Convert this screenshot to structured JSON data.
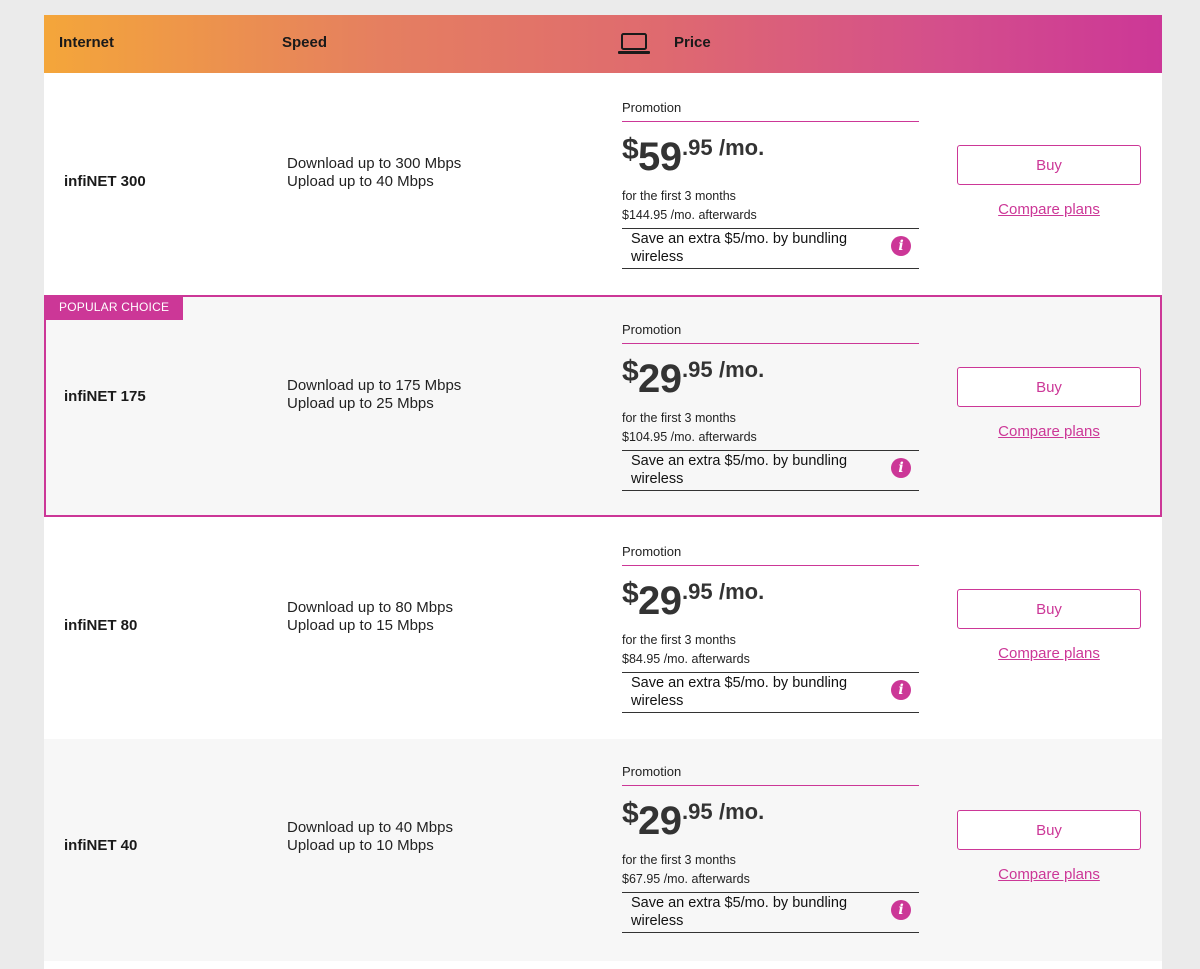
{
  "header": {
    "internet": "Internet",
    "speed": "Speed",
    "price": "Price"
  },
  "badge": "POPULAR CHOICE",
  "plans": [
    {
      "name": "infiNET 300",
      "download": "Download up to 300 Mbps",
      "upload": "Upload up to 40 Mbps",
      "promo_label": "Promotion",
      "dollar": "$",
      "price_main": "59",
      "price_cents": ".95",
      "price_unit": "/mo.",
      "term": "for the first 3 months",
      "after": "$144.95 /mo. afterwards",
      "bundle": "Save an extra $5/mo. by bundling wireless",
      "buy": "Buy",
      "compare": "Compare plans"
    },
    {
      "name": "infiNET 175",
      "download": "Download up to 175 Mbps",
      "upload": "Upload up to 25 Mbps",
      "promo_label": "Promotion",
      "dollar": "$",
      "price_main": "29",
      "price_cents": ".95",
      "price_unit": "/mo.",
      "term": "for the first 3 months",
      "after": "$104.95 /mo. afterwards",
      "bundle": "Save an extra $5/mo. by bundling wireless",
      "buy": "Buy",
      "compare": "Compare plans"
    },
    {
      "name": "infiNET 80",
      "download": "Download up to 80 Mbps",
      "upload": "Upload up to 15 Mbps",
      "promo_label": "Promotion",
      "dollar": "$",
      "price_main": "29",
      "price_cents": ".95",
      "price_unit": "/mo.",
      "term": "for the first 3 months",
      "after": "$84.95 /mo. afterwards",
      "bundle": "Save an extra $5/mo. by bundling wireless",
      "buy": "Buy",
      "compare": "Compare plans"
    },
    {
      "name": "infiNET 40",
      "download": "Download up to 40 Mbps",
      "upload": "Upload up to 10 Mbps",
      "promo_label": "Promotion",
      "dollar": "$",
      "price_main": "29",
      "price_cents": ".95",
      "price_unit": "/mo.",
      "term": "for the first 3 months",
      "after": "$67.95 /mo. afterwards",
      "bundle": "Save an extra $5/mo. by bundling wireless",
      "buy": "Buy",
      "compare": "Compare plans"
    }
  ],
  "colors": {
    "accent": "#cc3797",
    "header_start": "#f4a63a",
    "header_end": "#cc3797"
  },
  "icons": {
    "price_header": "laptop-icon",
    "bundle_info": "info-icon"
  }
}
